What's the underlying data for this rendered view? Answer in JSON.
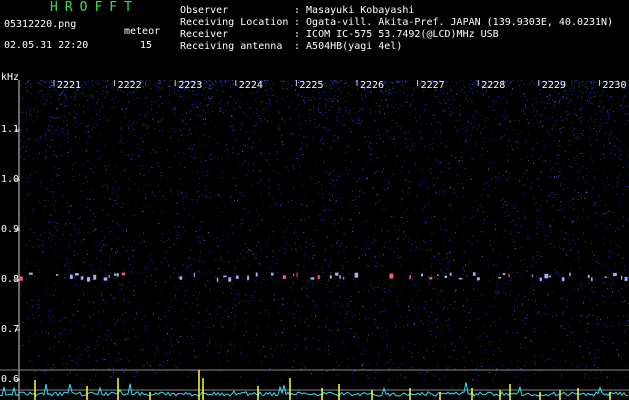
{
  "header": {
    "logo": "HROFFT",
    "filename": "05312220.png",
    "datetime": "02.05.31 22:20",
    "meteor_label": "meteor",
    "meteor_count": "15",
    "info": [
      {
        "label": "Observer",
        "value": ": Masayuki Kobayashi"
      },
      {
        "label": "Receiving Location",
        "value": ": Ogata-vill. Akita-Pref. JAPAN (139.9303E, 40.0231N)"
      },
      {
        "label": "Receiver",
        "value": ": ICOM IC-575 53.7492(@LCD)MHz USB"
      },
      {
        "label": "Receiving antenna",
        "value": ": A504HB(yagi 4el)"
      }
    ]
  },
  "axis": {
    "unit": "kHz",
    "y_ticks": [
      {
        "label": "1.1",
        "value": 1.1
      },
      {
        "label": "1.0",
        "value": 1.0
      },
      {
        "label": "0.9",
        "value": 0.9
      },
      {
        "label": "0.8",
        "value": 0.8
      },
      {
        "label": "0.7",
        "value": 0.7
      },
      {
        "label": "0.6",
        "value": 0.6
      }
    ],
    "time_ticks": [
      "2221",
      "2222",
      "2223",
      "2224",
      "2225",
      "2226",
      "2227",
      "2228",
      "2229",
      "2230"
    ]
  },
  "colors": {
    "logo": "#34e04a",
    "noise": "#3a48ff",
    "trace": "#33e0ff",
    "peak": "#ffff33",
    "axis": "#d0d0d0"
  }
}
